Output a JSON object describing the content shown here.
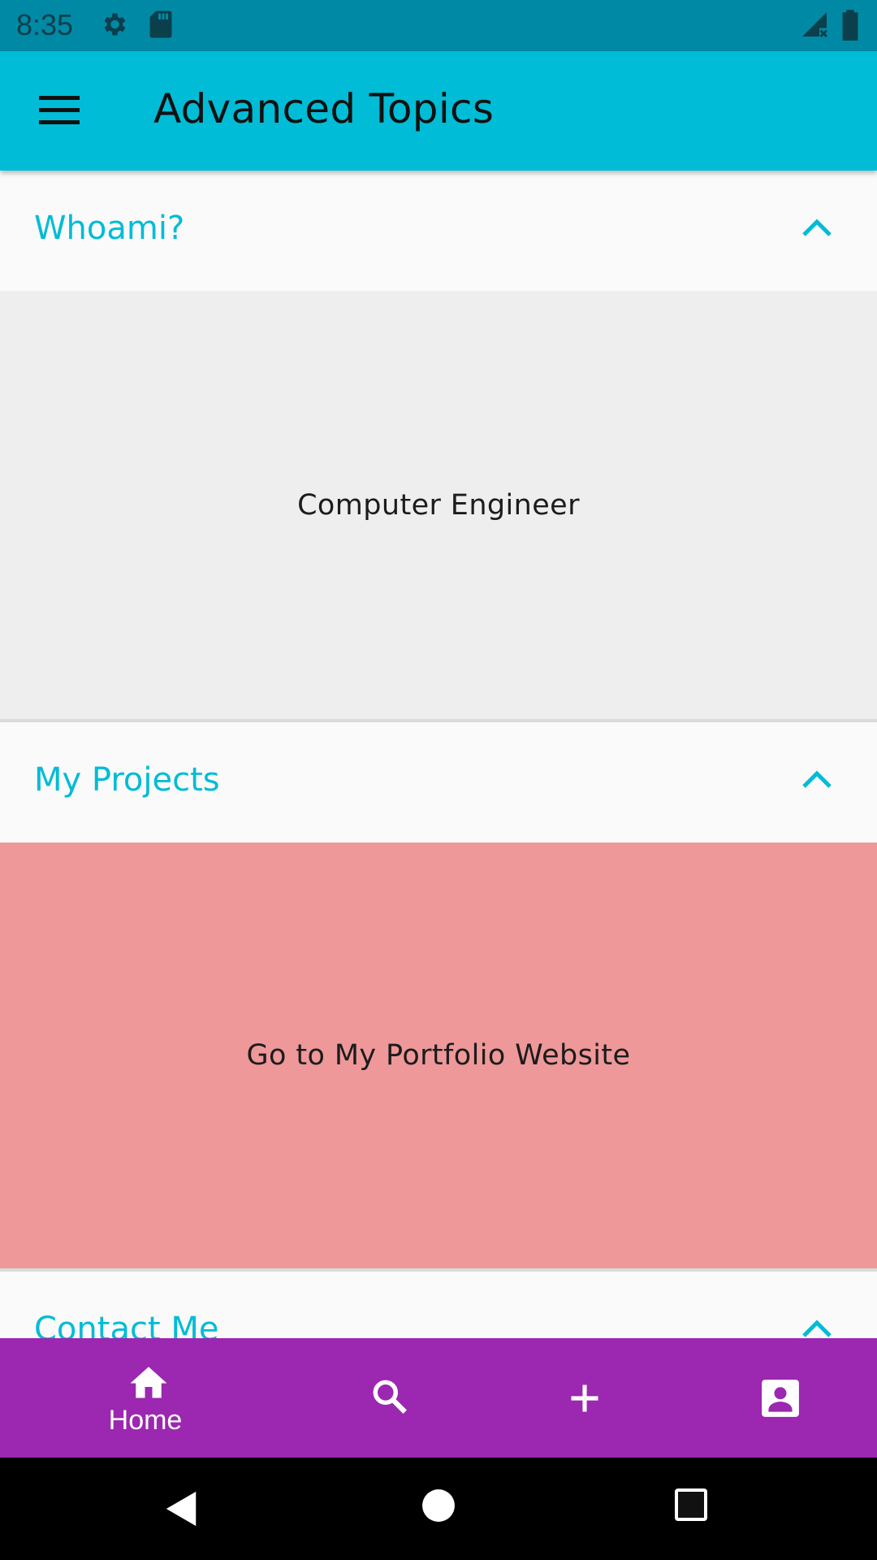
{
  "status_bar": {
    "time": "8:35",
    "icons": [
      "settings-icon",
      "sd-card-icon",
      "signal-no-data-icon",
      "battery-icon"
    ]
  },
  "app_bar": {
    "title": "Advanced Topics",
    "menu_icon": "hamburger-menu-icon",
    "color": "#00bcd6"
  },
  "sections": [
    {
      "title": "Whoami?",
      "expanded": true,
      "content": "Computer Engineer",
      "content_bg": "#eeeeee"
    },
    {
      "title": "My Projects",
      "expanded": true,
      "content": "Go to My Portfolio Website",
      "content_bg": "#ee989a"
    },
    {
      "title": "Contact Me",
      "expanded": true
    }
  ],
  "bottom_nav": {
    "color": "#9c27b0",
    "items": [
      {
        "icon": "home-icon",
        "label": "Home",
        "active": true
      },
      {
        "icon": "search-icon",
        "label": ""
      },
      {
        "icon": "add-icon",
        "label": ""
      },
      {
        "icon": "contact-icon",
        "label": ""
      }
    ]
  },
  "system_nav": {
    "icons": [
      "back-icon",
      "home-circle-icon",
      "recents-icon"
    ]
  }
}
